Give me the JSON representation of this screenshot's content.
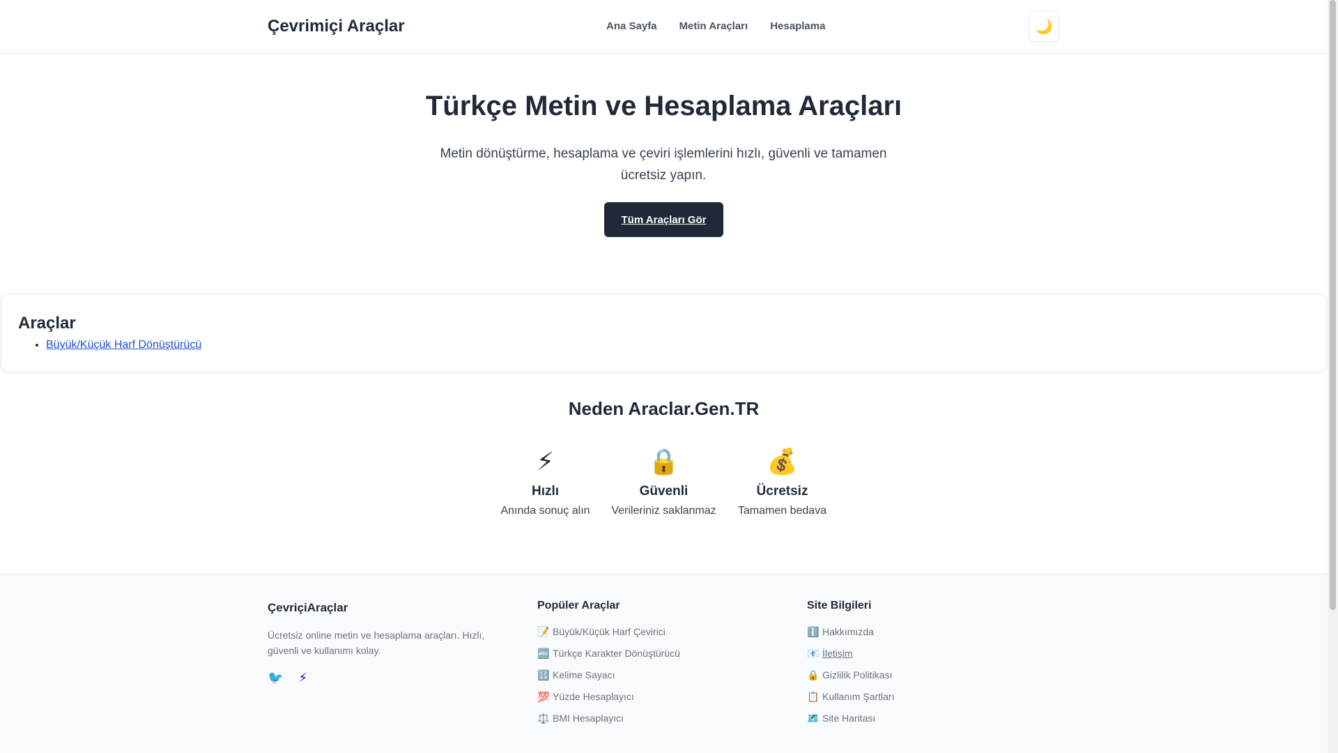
{
  "header": {
    "brand": "Çevrimiçi Araçlar",
    "nav": [
      "Ana Sayfa",
      "Metin Araçları",
      "Hesaplama"
    ],
    "theme_icon": "🌙"
  },
  "hero": {
    "title": "Türkçe Metin ve Hesaplama Araçları",
    "subtitle": "Metin dönüştürme, hesaplama ve çeviri işlemlerini hızlı, güvenli ve tamamen ücretsiz yapın.",
    "button": "Tüm Araçları Gör"
  },
  "tools": {
    "title": "Araçlar",
    "items": [
      "Büyük/Küçük Harf Dönüştürücü"
    ]
  },
  "why": {
    "title": "Neden Araclar.Gen.TR",
    "features": [
      {
        "icon": "⚡",
        "title": "Hızlı",
        "desc": "Anında sonuç alın"
      },
      {
        "icon": "🔒",
        "title": "Güvenli",
        "desc": "Verileriniz saklanmaz"
      },
      {
        "icon": "💰",
        "title": "Ücretsiz",
        "desc": "Tamamen bedava"
      }
    ]
  },
  "footer": {
    "brand": "ÇevriçiAraçlar",
    "desc": "Ücretsiz online metin ve hesaplama araçları. Hızlı, güvenli ve kullanımı kolay.",
    "social": [
      "🐦",
      "⚡"
    ],
    "popular_title": "Popüler Araçlar",
    "popular": [
      {
        "icon": "📝",
        "label": "Büyük/Küçük Harf Çevirici"
      },
      {
        "icon": "🔤",
        "label": "Türkçe Karakter Dönüştürücü"
      },
      {
        "icon": "🔢",
        "label": "Kelime Sayacı"
      },
      {
        "icon": "💯",
        "label": "Yüzde Hesaplayıcı"
      },
      {
        "icon": "⚖️",
        "label": "BMI Hesaplayıcı"
      }
    ],
    "info_title": "Site Bilgileri",
    "info": [
      {
        "icon": "ℹ️",
        "label": "Hakkımızda"
      },
      {
        "icon": "📧",
        "label": "İletişim"
      },
      {
        "icon": "🔒",
        "label": "Gizlilik Politikası"
      },
      {
        "icon": "📋",
        "label": "Kullanım Şartları"
      },
      {
        "icon": "🗺️",
        "label": "Site Haritası"
      }
    ]
  }
}
